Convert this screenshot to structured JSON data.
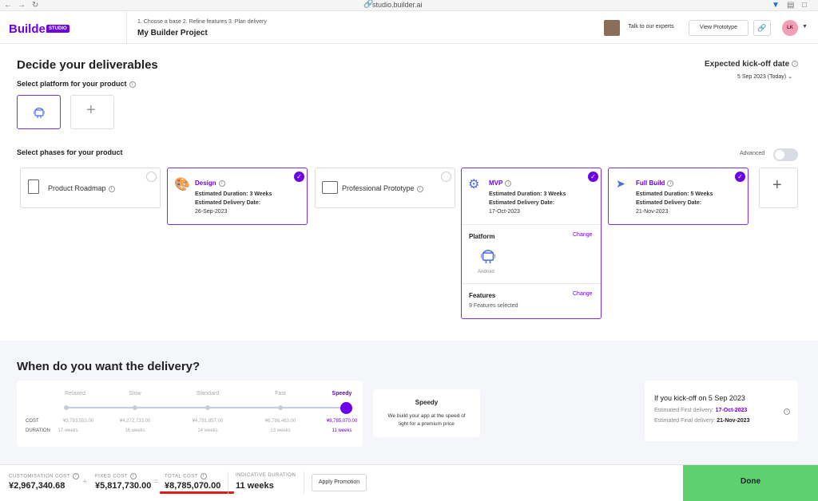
{
  "browser": {
    "url": "studio.builder.ai"
  },
  "header": {
    "logo": "Builder",
    "logo_badge": "STUDIO",
    "steps": "1. Choose a base   2. Refine features   3. Plan delivery",
    "project_name": "My Builder Project",
    "talk_button": "Talk to our experts",
    "prototype_button": "View Prototype",
    "avatar_initials": "LK"
  },
  "deliverables": {
    "title": "Decide your deliverables",
    "platform_label": "Select platform for your product",
    "phases_label": "Select phases for your product",
    "advanced_label": "Advanced",
    "kickoff_title": "Expected kick-off date",
    "kickoff_date": "5 Sep 2023 (Today)"
  },
  "phases": {
    "roadmap": {
      "name": "Product Roadmap"
    },
    "design": {
      "name": "Design",
      "duration": "Estimated Duration: 3 Weeks",
      "delivery_label": "Estimated Delivery Date:",
      "delivery_date": "26-Sep-2023"
    },
    "prototype": {
      "name": "Professional Prototype"
    },
    "mvp": {
      "name": "MVP",
      "duration": "Estimated Duration: 3 Weeks",
      "delivery_label": "Estimated Delivery Date:",
      "delivery_date": "17-Oct-2023",
      "platform_label": "Platform",
      "platform_change": "Change",
      "platform_name": "Android",
      "features_label": "Features",
      "features_change": "Change",
      "features_value": "9 Features selected"
    },
    "fullbuild": {
      "name": "Full Build",
      "duration": "Estimated Duration: 5 Weeks",
      "delivery_label": "Estimated Delivery Date:",
      "delivery_date": "21-Nov-2023"
    }
  },
  "delivery": {
    "title": "When do you want the delivery?",
    "speeds": [
      "Relaxed",
      "Slow",
      "Standard",
      "Fast",
      "Speedy"
    ],
    "cost_label": "COST",
    "duration_label": "DURATION",
    "costs": [
      "¥3,793,553.00",
      "¥4,272,733.00",
      "¥4,791,857.00",
      "¥6,786,463.00",
      "¥8,785,070.00"
    ],
    "durations": [
      "17 weeks",
      "16 weeks",
      "14 weeks",
      "13 weeks",
      "11 weeks"
    ],
    "selected_index": 4,
    "speedy_title": "Speedy",
    "speedy_desc": "We build your app at the speed of light for a premium price",
    "kickoff_summary": "If you kick-off on 5 Sep 2023",
    "first_delivery_label": "Estimated First delivery:",
    "first_delivery_date": "17-Oct-2023",
    "final_delivery_label": "Estimated Final delivery:",
    "final_delivery_date": "21-Nov-2023"
  },
  "footer": {
    "customisation_label": "CUSTOMISATION COST",
    "customisation_value": "¥2,967,340.68",
    "fixed_label": "FIXED COST",
    "fixed_value": "¥5,817,730.00",
    "total_label": "TOTAL COST",
    "total_value": "¥8,785,070.00",
    "duration_label": "INDICATIVE DURATION",
    "duration_value": "11 weeks",
    "promo_button": "Apply Promotion",
    "done_button": "Done"
  },
  "colors": {
    "accent": "#6c00ea",
    "done": "#5fd06d",
    "underline": "#e01b1b"
  }
}
